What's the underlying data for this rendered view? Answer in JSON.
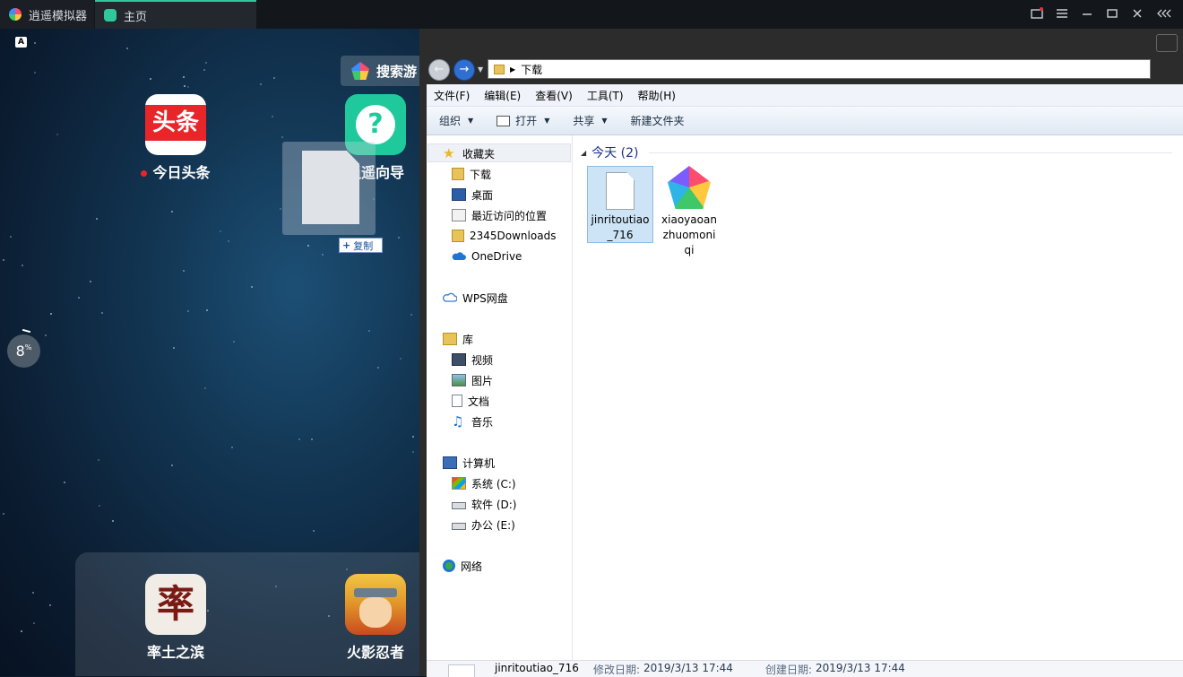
{
  "emulator": {
    "app_title": "逍遥模拟器",
    "tab_title": "主页",
    "controls": [
      "screenshot-icon",
      "menu-icon",
      "minimize-icon",
      "maximize-icon",
      "close-icon",
      "collapse-icon"
    ],
    "accent": "#2fc89a"
  },
  "android": {
    "corner_badge": "A",
    "search_label": "搜索游",
    "progress_text": "8",
    "progress_unit": "%",
    "drag_badge": "复制",
    "apps": [
      {
        "label": "今日头条",
        "icon_text": "头条",
        "color": "#e8262a"
      },
      {
        "label": "逍遥向导",
        "icon_text": "?",
        "color": "#1fc99b"
      }
    ],
    "dock_apps": [
      {
        "label": "率土之滨",
        "icon_text": "率",
        "color": "#f1ede6"
      },
      {
        "label": "火影忍者",
        "icon_text": "",
        "color": "#e8b23a"
      }
    ]
  },
  "explorer": {
    "address_path": "下载",
    "menu": [
      "文件(F)",
      "编辑(E)",
      "查看(V)",
      "工具(T)",
      "帮助(H)"
    ],
    "toolbar": {
      "organize": "组织",
      "open": "打开",
      "share": "共享",
      "new_folder": "新建文件夹"
    },
    "nav": {
      "favorites": "收藏夹",
      "downloads": "下载",
      "desktop": "桌面",
      "recent": "最近访问的位置",
      "downloads2345": "2345Downloads",
      "onedrive": "OneDrive",
      "wps": "WPS网盘",
      "library": "库",
      "video": "视频",
      "pictures": "图片",
      "documents": "文档",
      "music": "音乐",
      "computer": "计算机",
      "drive_c": "系统 (C:)",
      "drive_d": "软件 (D:)",
      "drive_e": "办公 (E:)",
      "network": "网络"
    },
    "group_header": "今天 (2)",
    "files": [
      {
        "name_line1": "jinritoutiao",
        "name_line2": "_716",
        "name_line3": ""
      },
      {
        "name_line1": "xiaoyaoan",
        "name_line2": "zhuomoni",
        "name_line3": "qi"
      }
    ],
    "status": {
      "name": "jinritoutiao_716",
      "modified_label": "修改日期:",
      "modified_value": "2019/3/13 17:44",
      "created_label": "创建日期:",
      "created_value": "2019/3/13 17:44"
    }
  }
}
